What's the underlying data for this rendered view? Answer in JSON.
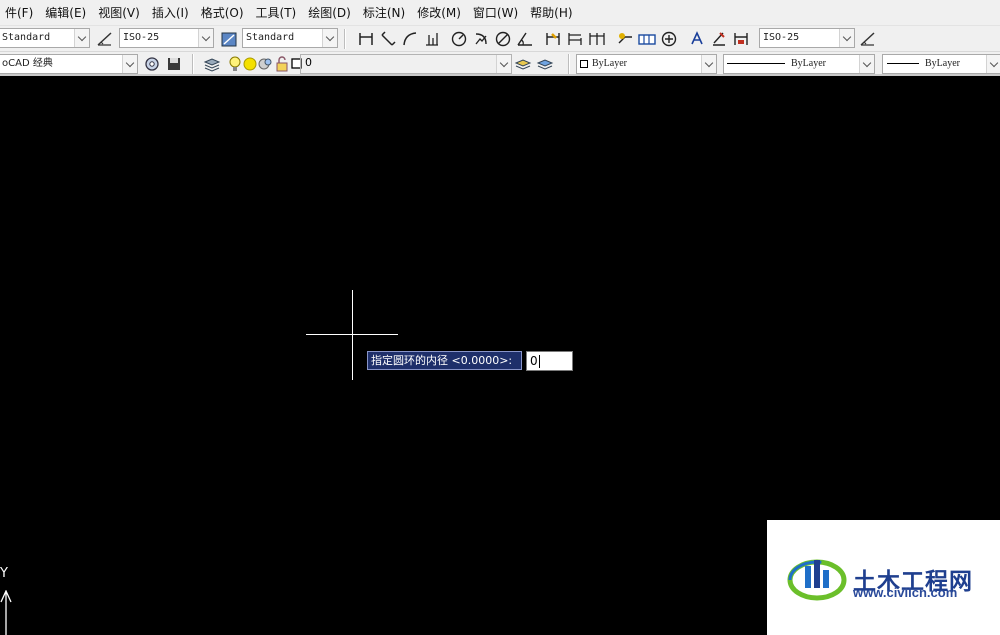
{
  "menu": [
    "件(F)",
    "编辑(E)",
    "视图(V)",
    "插入(I)",
    "格式(O)",
    "工具(T)",
    "绘图(D)",
    "标注(N)",
    "修改(M)",
    "窗口(W)",
    "帮助(H)"
  ],
  "toolbar": {
    "text_style": "Standard",
    "dim_style": "ISO-25",
    "table_style": "Standard",
    "mleader_style": "ISO-25",
    "workspace": "oCAD 经典",
    "layer": "0",
    "color": "ByLayer",
    "linetype": "ByLayer",
    "lineweight": "ByLayer"
  },
  "command": {
    "prompt": "指定圆环的内径 <0.0000>:",
    "input_value": "0"
  },
  "ucs": {
    "y_label": "Y"
  },
  "watermark": {
    "title": "土木工程网",
    "url": "www.civilcn.com"
  },
  "colors": {
    "canvas": "#000000",
    "prompt_bg": "#1e2f6a",
    "watermark_blue": "#1f3f8f",
    "watermark_green": "#6bbf2a"
  }
}
